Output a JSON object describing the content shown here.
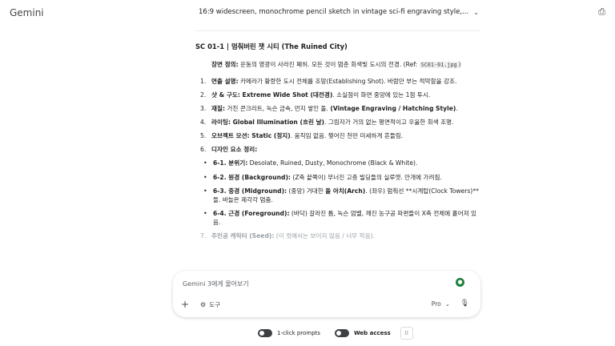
{
  "app": {
    "brand": "Gemini"
  },
  "header": {
    "conversation_title": "16:9 widescreen, monochrome pencil sketch in vintage sci-fi engraving style,..."
  },
  "message": {
    "heading": "SC 01-1 | 멈춰버린 잿 시티 (The Ruined City)",
    "definition": {
      "label": "장면 정의:",
      "text": " 운동의 영광이 사라진 폐허. 모든 것이 멈춘 회색빛 도시의 전경. (Ref: ",
      "code": "SC01-01.jpg",
      "suffix": ")"
    },
    "items": [
      {
        "num": "1.",
        "label": "연출 설명:",
        "text": " 카메라가 황량한 도시 전체를 조망(Establishing Shot). 바람만 부는 적막함을 강조."
      },
      {
        "num": "2.",
        "label": "샷 & 구도: Extreme Wide Shot (대전경)",
        "text": ". 소실점이 화면 중앙에 있는 1점 투시."
      },
      {
        "num": "3.",
        "label": "재질:",
        "text": " 거친 콘크리트, 녹슨 금속, 먼지 쌓인 돌. ",
        "bold2": "(Vintage Engraving / Hatching Style)",
        "text2": "."
      },
      {
        "num": "4.",
        "label": "라이팅: Global Illumination (흐린 날)",
        "text": ". 그림자가 거의 없는 평면적이고 우울한 회색 조명."
      },
      {
        "num": "5.",
        "label": "오브젝트 모션: Static (정지)",
        "text": ". 움직임 없음. 찢어진 천만 미세하게 흔들림."
      },
      {
        "num": "6.",
        "label": "디자인 요소 정리:",
        "text": ""
      }
    ],
    "subitems": [
      {
        "label": "6-1. 분위기:",
        "text": " Desolate, Ruined, Dusty, Monochrome (Black & White)."
      },
      {
        "label": "6-2. 원경 (Background):",
        "text": " (Z축 끝쪽이) 무너진 고층 빌딩들의 실루엣. 안개에 가려짐."
      },
      {
        "label": "6-3. 중경 (Midground):",
        "text": " (중앙) 거대한 ",
        "bold2": "돌 아치(Arch)",
        "text2": ". (좌우) 멈춰선 **시계탑(Clock Towers)**들. 바늘은 제각각 멈춤."
      },
      {
        "label": "6-4. 근경 (Foreground):",
        "text": " (바닥) 갈라진 틈, 녹슨 엄벨, 깨진 농구공 파편들이 X축 전체에 흩어져 있음."
      }
    ],
    "faded_item": {
      "num": "7.",
      "label": "주인공 캐릭터 (Seed):",
      "text": " (이 컷에서는 보이지 않음 / 너무 작음)."
    }
  },
  "composer": {
    "placeholder": "Gemini 3에게 물어보기",
    "tools_label": "도구",
    "model_label": "Pro"
  },
  "footer": {
    "one_click_label": "1-click prompts",
    "web_access_label": "Web access"
  }
}
